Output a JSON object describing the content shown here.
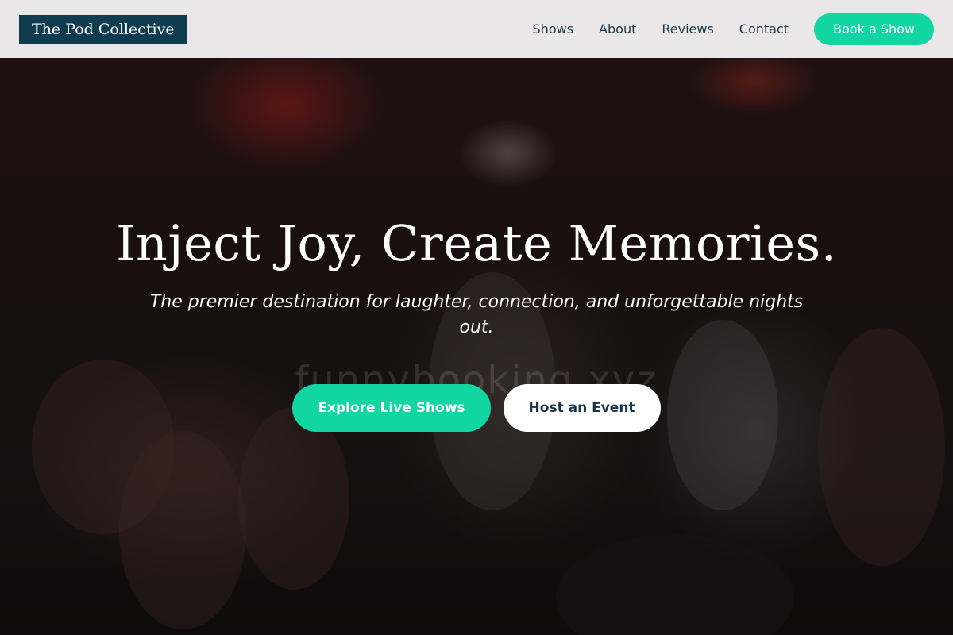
{
  "header": {
    "logo_text": "The Pod Collective",
    "nav": [
      {
        "label": "Shows"
      },
      {
        "label": "About"
      },
      {
        "label": "Reviews"
      },
      {
        "label": "Contact"
      }
    ],
    "cta_label": "Book a Show"
  },
  "hero": {
    "title": "Inject Joy, Create Memories.",
    "subtitle": "The premier destination for laughter, connection, and unforgettable nights out.",
    "watermark": "funnybooking.xyz",
    "primary_button": "Explore Live Shows",
    "secondary_button": "Host an Event"
  },
  "colors": {
    "accent": "#12d6a2",
    "brand_dark": "#0f3d4f",
    "header_bg": "#e9e7e8"
  }
}
